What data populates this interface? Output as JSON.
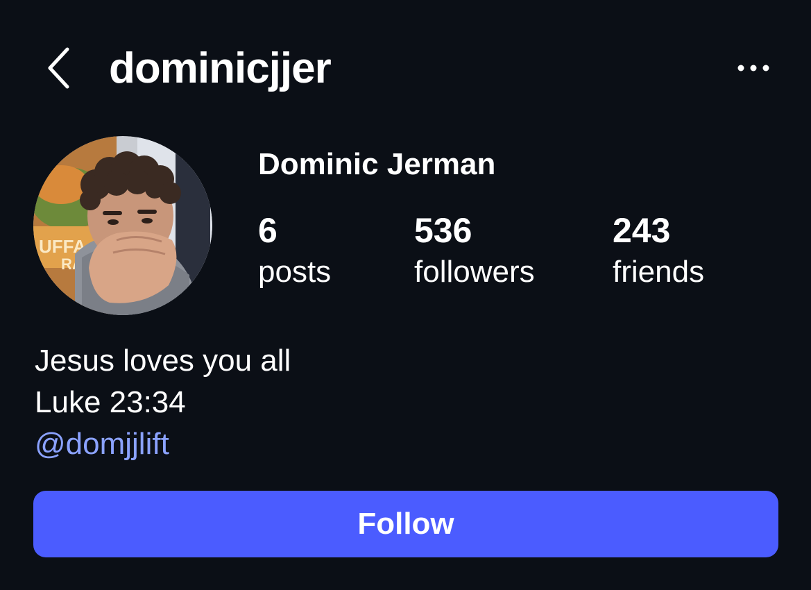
{
  "header": {
    "back_icon": "chevron-left-icon",
    "username": "dominicjjer",
    "more_icon": "more-horizontal-icon"
  },
  "profile": {
    "display_name": "Dominic Jerman",
    "avatar_description": "profile-photo",
    "stats": [
      {
        "value": "6",
        "label": "posts"
      },
      {
        "value": "536",
        "label": "followers"
      },
      {
        "value": "243",
        "label": "friends"
      }
    ],
    "bio": {
      "line1": "Jesus loves you all",
      "line2": "Luke 23:34",
      "link": "@domjjlift"
    }
  },
  "actions": {
    "follow_label": "Follow"
  },
  "colors": {
    "background": "#0b0f16",
    "text": "#ffffff",
    "link": "#8ba2ff",
    "follow_button": "#4b5cff"
  }
}
